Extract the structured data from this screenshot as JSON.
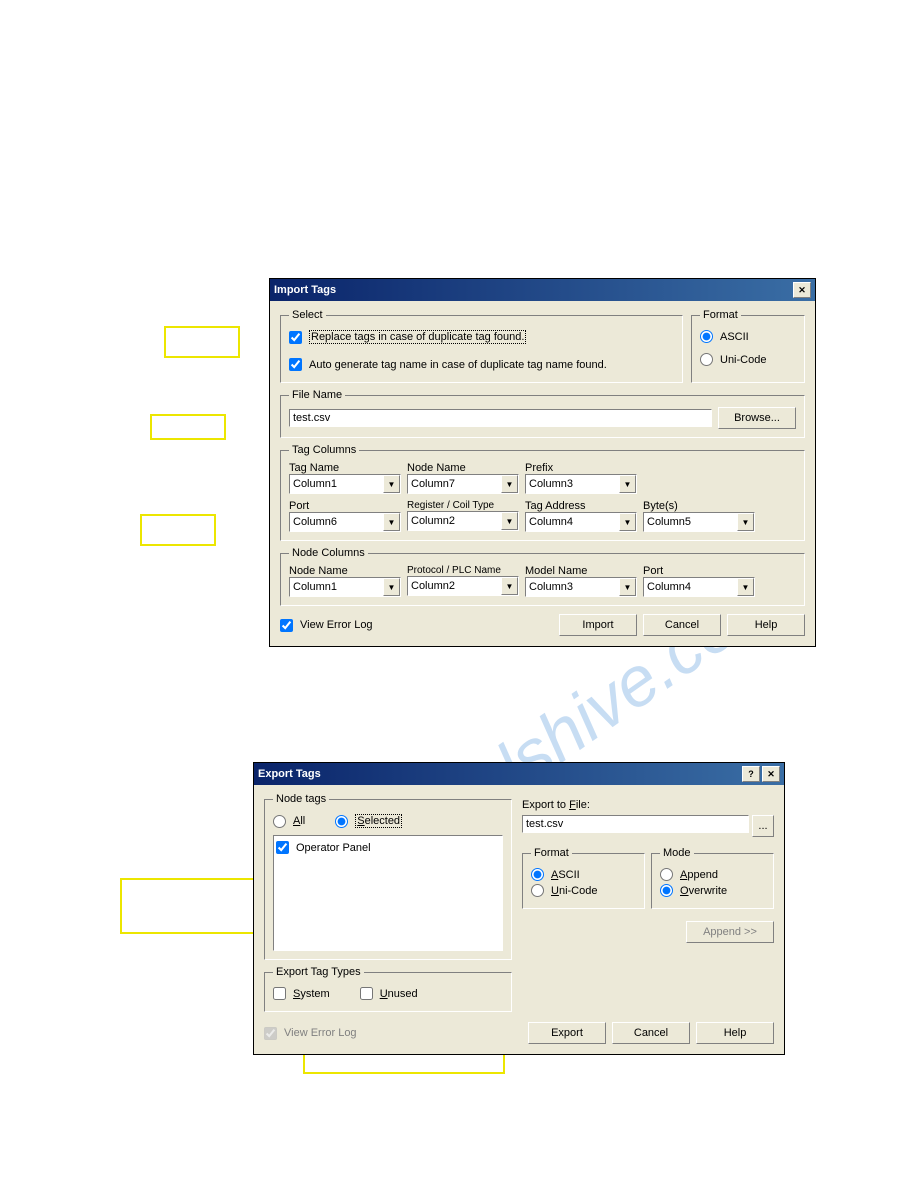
{
  "import": {
    "title": "Import Tags",
    "select": {
      "legend": "Select",
      "replace": "Replace tags in case of duplicate tag found.",
      "autogen": "Auto generate tag name in case of duplicate tag name found."
    },
    "format": {
      "legend": "Format",
      "ascii": "ASCII",
      "unicode": "Uni-Code"
    },
    "filename": {
      "legend": "File Name",
      "value": "test.csv",
      "browse": "Browse..."
    },
    "tagcols": {
      "legend": "Tag Columns",
      "labels": {
        "tagname": "Tag Name",
        "nodename": "Node Name",
        "prefix": "Prefix",
        "port": "Port",
        "regtype": "Register / Coil Type",
        "tagaddr": "Tag Address",
        "bytes": "Byte(s)"
      },
      "vals": {
        "tagname": "Column1",
        "nodename": "Column7",
        "prefix": "Column3",
        "port": "Column6",
        "regtype": "Column2",
        "tagaddr": "Column4",
        "bytes": "Column5"
      }
    },
    "nodecols": {
      "legend": "Node Columns",
      "labels": {
        "nodename": "Node Name",
        "protocol": "Protocol / PLC Name",
        "model": "Model Name",
        "port": "Port"
      },
      "vals": {
        "nodename": "Column1",
        "protocol": "Column2",
        "model": "Column3",
        "port": "Column4"
      }
    },
    "viewerror": "View Error Log",
    "buttons": {
      "import": "Import",
      "cancel": "Cancel",
      "help": "Help"
    }
  },
  "export": {
    "title": "Export Tags",
    "nodetags": {
      "legend": "Node tags",
      "all": "All",
      "selected": "Selected",
      "item": "Operator Panel"
    },
    "tagtypes": {
      "legend": "Export Tag Types",
      "system": "System",
      "unused": "Unused"
    },
    "exportto": "Export to File:",
    "filevalue": "test.csv",
    "format": {
      "legend": "Format",
      "ascii": "ASCII",
      "unicode": "Uni-Code"
    },
    "mode": {
      "legend": "Mode",
      "append": "Append",
      "overwrite": "Overwrite"
    },
    "appendbtn": "Append >>",
    "viewerror": "View Error Log",
    "buttons": {
      "export": "Export",
      "cancel": "Cancel",
      "help": "Help"
    }
  }
}
